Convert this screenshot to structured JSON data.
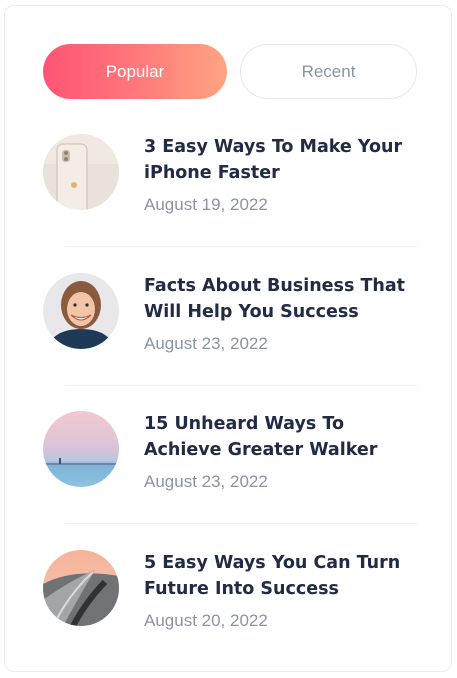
{
  "tabs": [
    {
      "label": "Popular",
      "active": true
    },
    {
      "label": "Recent",
      "active": false
    }
  ],
  "posts": [
    {
      "title": "3 Easy Ways To Make Your iPhone Faster",
      "date": "August 19, 2022",
      "thumbnail": "iphone-back-photo"
    },
    {
      "title": "Facts About Business That Will Help You Success",
      "date": "August 23, 2022",
      "thumbnail": "smiling-woman-portrait"
    },
    {
      "title": "15 Unheard Ways To Achieve Greater Walker",
      "date": "August 23, 2022",
      "thumbnail": "pastel-sky-horizon"
    },
    {
      "title": "5 Easy Ways You Can Turn Future Into Success",
      "date": "August 20, 2022",
      "thumbnail": "winding-road-aerial"
    }
  ],
  "colors": {
    "accent_gradient_start": "#ff5475",
    "accent_gradient_end": "#ffa582",
    "title_text": "#222b45",
    "muted_text": "#8a93a6"
  }
}
